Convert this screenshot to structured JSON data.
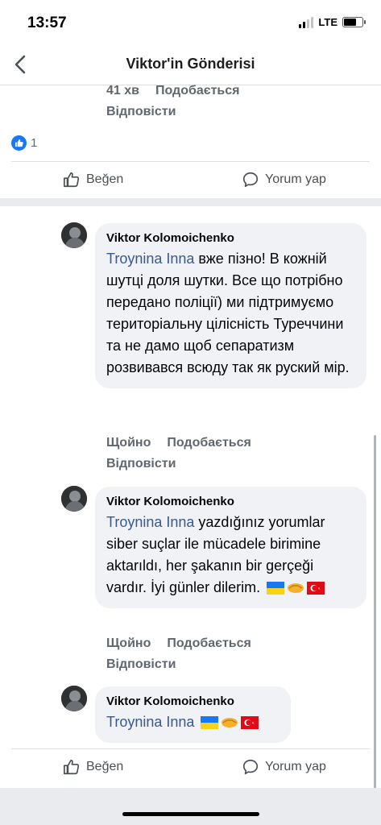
{
  "status_bar": {
    "time": "13:57",
    "network": "LTE"
  },
  "header": {
    "title": "Viktor'in Gönderisi"
  },
  "previous_comment": {
    "time": "41 хв",
    "like_label": "Подобається",
    "reply_label": "Відповісти"
  },
  "post_reactions": {
    "count": "1"
  },
  "actions": {
    "like_label": "Beğen",
    "comment_label": "Yorum yap"
  },
  "comments": [
    {
      "author": "Viktor Kolomoichenko",
      "mention": "Troynina Inna",
      "text": " вже пізно! В кожній шутці доля шутки. Все що потрібно передано поліції) ми підтримуємо територіальну цілісність Туреччини та не дамо щоб сепаратизм розвивався всюду так як руский мір.",
      "time": "Щойно",
      "like_label": "Подобається",
      "reply_label": "Відповісти"
    },
    {
      "author": "Viktor Kolomoichenko",
      "mention": "Troynina Inna",
      "text": " yazdığınız yorumlar siber suçlar ile mücadele birimine aktarıldı, her şakanın bir gerçeği vardır. İyi günler dilerim.",
      "emoji": [
        "ukraine-flag",
        "handshake",
        "turkey-flag"
      ],
      "time": "Щойно",
      "like_label": "Подобається",
      "reply_label": "Відповісти"
    },
    {
      "author": "Viktor Kolomoichenko",
      "mention": "Troynina Inna",
      "text": "",
      "emoji": [
        "ukraine-flag",
        "handshake",
        "turkey-flag"
      ]
    }
  ],
  "colors": {
    "facebook_blue": "#1877f2",
    "mention_blue": "#385898",
    "bubble_bg": "#f0f2f5",
    "meta_gray": "#606770"
  },
  "icons": [
    "back-chevron-icon",
    "like-thumb-icon",
    "comment-bubble-icon",
    "ukraine-flag-icon",
    "handshake-icon",
    "turkey-flag-icon"
  ]
}
